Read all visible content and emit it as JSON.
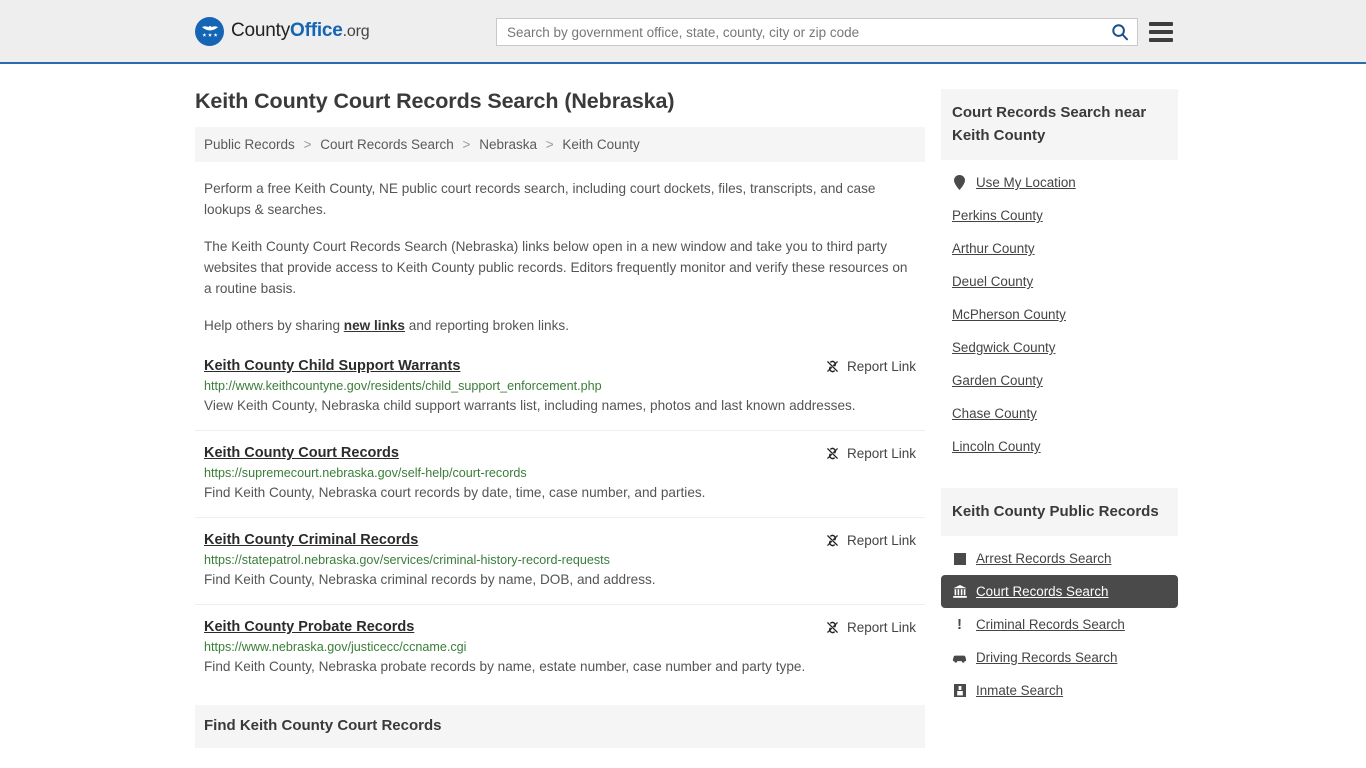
{
  "header": {
    "logo_text_county": "County",
    "logo_text_office": "Office",
    "logo_text_dotorg": ".org",
    "logo_icon": "eagle-shield-logo",
    "search": {
      "placeholder": "Search by government office, state, county, city or zip code",
      "value": "",
      "search_icon": "search-icon"
    },
    "menu_icon": "hamburger-menu-icon"
  },
  "page": {
    "title": "Keith County Court Records Search (Nebraska)"
  },
  "breadcrumb": {
    "items": [
      {
        "label": "Public Records"
      },
      {
        "label": "Court Records Search"
      },
      {
        "label": "Nebraska"
      },
      {
        "label": "Keith County"
      }
    ],
    "separator": ">"
  },
  "intro": {
    "p1": "Perform a free Keith County, NE public court records search, including court dockets, files, transcripts, and case lookups & searches.",
    "p2": "The Keith County Court Records Search (Nebraska) links below open in a new window and take you to third party websites that provide access to Keith County public records. Editors frequently monitor and verify these resources on a routine basis.",
    "p3_before": "Help others by sharing ",
    "p3_link": "new links",
    "p3_after": " and reporting broken links."
  },
  "results": {
    "report_label": "Report Link",
    "report_icon": "unlink-icon",
    "items": [
      {
        "title": "Keith County Child Support Warrants",
        "url": "http://www.keithcountyne.gov/residents/child_support_enforcement.php",
        "description": "View Keith County, Nebraska child support warrants list, including names, photos and last known addresses."
      },
      {
        "title": "Keith County Court Records",
        "url": "https://supremecourt.nebraska.gov/self-help/court-records",
        "description": "Find Keith County, Nebraska court records by date, time, case number, and parties."
      },
      {
        "title": "Keith County Criminal Records",
        "url": "https://statepatrol.nebraska.gov/services/criminal-history-record-requests",
        "description": "Find Keith County, Nebraska criminal records by name, DOB, and address."
      },
      {
        "title": "Keith County Probate Records",
        "url": "https://www.nebraska.gov/justicecc/ccname.cgi",
        "description": "Find Keith County, Nebraska probate records by name, estate number, case number and party type."
      }
    ]
  },
  "bottom_section": {
    "heading": "Find Keith County Court Records"
  },
  "sidebar": {
    "nearby": {
      "heading": "Court Records Search near Keith County",
      "items": [
        {
          "label": "Use My Location",
          "icon": "map-pin-icon"
        },
        {
          "label": "Perkins County",
          "icon": ""
        },
        {
          "label": "Arthur County",
          "icon": ""
        },
        {
          "label": "Deuel County",
          "icon": ""
        },
        {
          "label": "McPherson County",
          "icon": ""
        },
        {
          "label": "Sedgwick County",
          "icon": ""
        },
        {
          "label": "Garden County",
          "icon": ""
        },
        {
          "label": "Chase County",
          "icon": ""
        },
        {
          "label": "Lincoln County",
          "icon": ""
        }
      ]
    },
    "public_records": {
      "heading": "Keith County Public Records",
      "items": [
        {
          "label": "Arrest Records Search",
          "icon": "square-icon",
          "active": false
        },
        {
          "label": "Court Records Search",
          "icon": "courthouse-icon",
          "active": true
        },
        {
          "label": "Criminal Records Search",
          "icon": "exclamation-icon",
          "active": false
        },
        {
          "label": "Driving Records Search",
          "icon": "car-icon",
          "active": false
        },
        {
          "label": "Inmate Search",
          "icon": "jail-icon",
          "active": false
        }
      ]
    }
  },
  "colors": {
    "accent_blue": "#1565b5",
    "header_bg": "#eeeeee",
    "header_border": "#2b6cb0",
    "url_green": "#3a7d38",
    "panel_bg": "#f5f5f5",
    "active_bg": "#4a4a4a"
  }
}
